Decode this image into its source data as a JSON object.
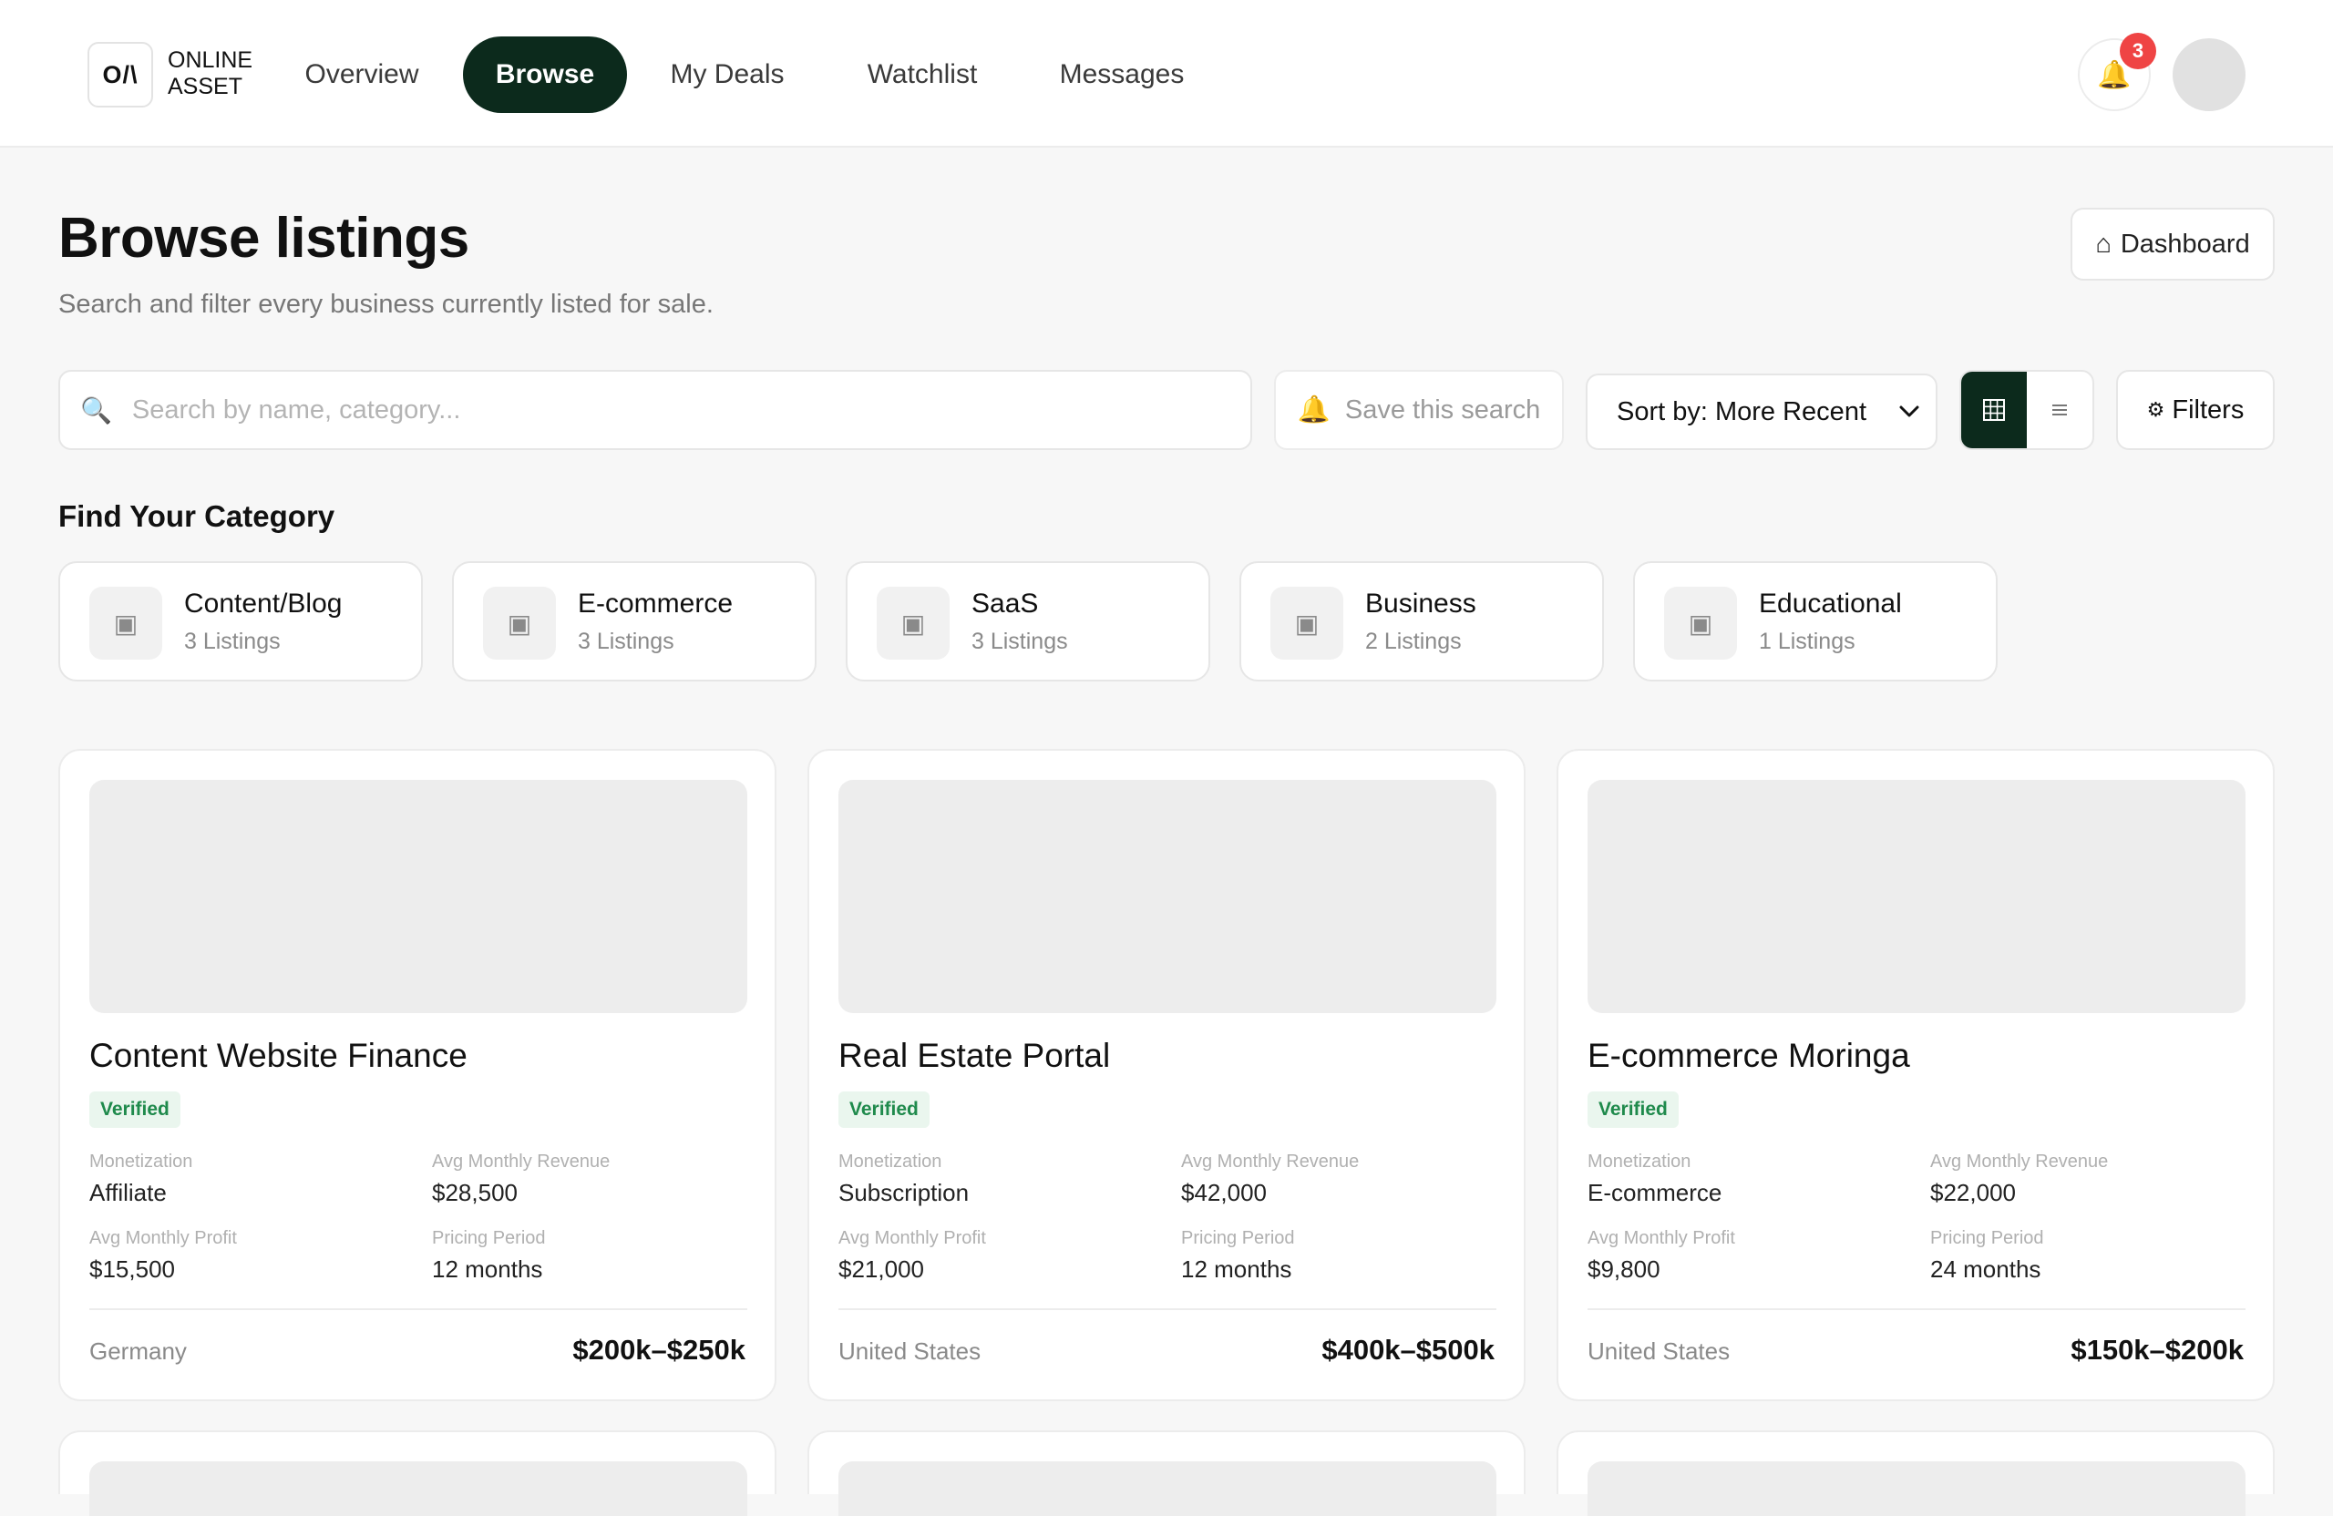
{
  "brand": {
    "mark": "O/\\",
    "name": "ONLINE ASSET"
  },
  "nav": [
    {
      "label": "Overview",
      "active": false
    },
    {
      "label": "Browse",
      "active": true
    },
    {
      "label": "My Deals",
      "active": false
    },
    {
      "label": "Watchlist",
      "active": false
    },
    {
      "label": "Messages",
      "active": false
    }
  ],
  "notifications": {
    "icon": "bell-icon",
    "count": "3"
  },
  "page": {
    "title": "Browse listings",
    "subtitle": "Search and filter every business currently listed for sale.",
    "dashboard_label": "Dashboard",
    "dashboard_icon": "home-icon"
  },
  "toolbar": {
    "search_placeholder": "Search by name, category...",
    "search_value": "",
    "save_search_label": "Save this search",
    "sort_label": "Sort by: More Recent",
    "view_modes": [
      "grid",
      "list"
    ],
    "active_view": "grid",
    "filters_label": "Filters"
  },
  "categories": {
    "heading": "Find Your Category",
    "items": [
      {
        "name": "Content/Blog",
        "count": "3 Listings"
      },
      {
        "name": "E-commerce",
        "count": "3 Listings"
      },
      {
        "name": "SaaS",
        "count": "3 Listings"
      },
      {
        "name": "Business",
        "count": "2 Listings"
      },
      {
        "name": "Educational",
        "count": "1 Listings"
      }
    ]
  },
  "listing_labels": {
    "monetization": "Monetization",
    "revenue": "Avg Monthly Revenue",
    "profit": "Avg Monthly Profit",
    "period": "Pricing Period"
  },
  "listings": [
    {
      "title": "Content Website Finance",
      "badge": "Verified",
      "monetization": "Affiliate",
      "revenue": "$28,500",
      "profit": "$15,500",
      "period": "12 months",
      "location": "Germany",
      "price": "$200k–$250k"
    },
    {
      "title": "Real Estate Portal",
      "badge": "Verified",
      "monetization": "Subscription",
      "revenue": "$42,000",
      "profit": "$21,000",
      "period": "12 months",
      "location": "United States",
      "price": "$400k–$500k"
    },
    {
      "title": "E-commerce Moringa",
      "badge": "Verified",
      "monetization": "E-commerce",
      "revenue": "$22,000",
      "profit": "$9,800",
      "period": "24 months",
      "location": "United States",
      "price": "$150k–$200k"
    }
  ],
  "colors": {
    "accent": "#0c2a1c",
    "badge_bg": "#eaf6ee",
    "badge_text": "#1f8a4c",
    "notification": "#ef4444"
  }
}
